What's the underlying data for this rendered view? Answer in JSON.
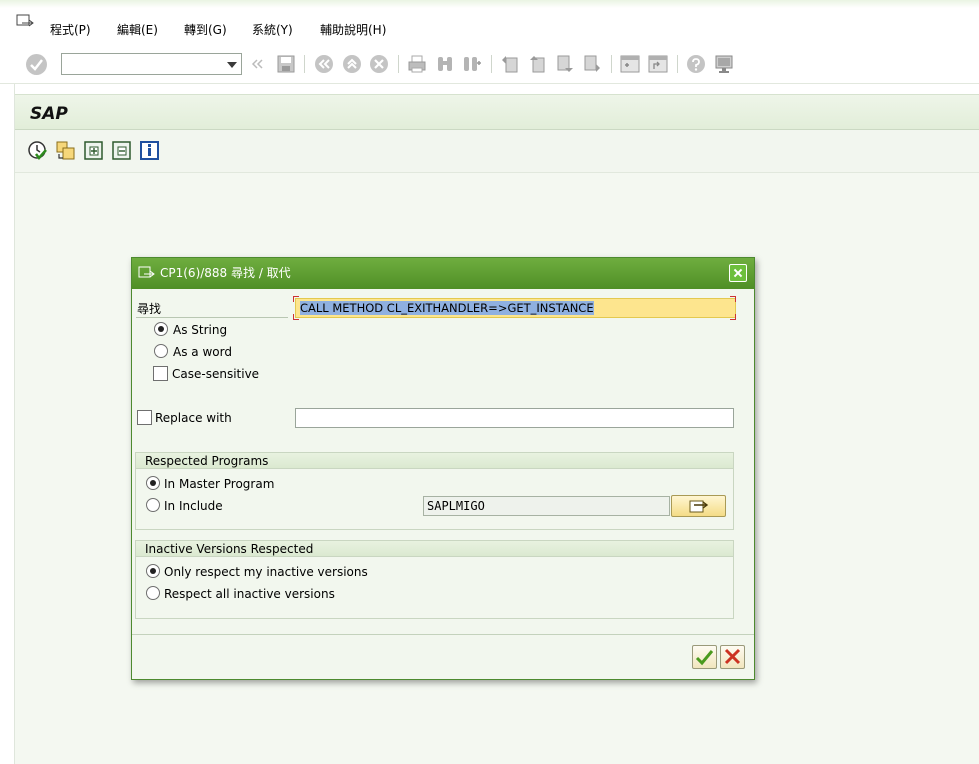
{
  "menu": {
    "items": [
      "程式(P)",
      "編輯(E)",
      "轉到(G)",
      "系統(Y)",
      "輔助說明(H)"
    ]
  },
  "toolbar": {
    "command_value": "",
    "icons": [
      "enter-icon",
      "save-icon",
      "back-icon",
      "exit-icon",
      "cancel-icon",
      "print-icon",
      "find-icon",
      "find-next-icon",
      "first-page-icon",
      "previous-page-icon",
      "next-page-icon",
      "last-page-icon",
      "create-session-icon",
      "shortcut-icon",
      "help-icon",
      "layout-icon"
    ]
  },
  "screen": {
    "title": "SAP",
    "app_icons": [
      "test-icon",
      "display-object-icon",
      "expand-icon",
      "collapse-icon",
      "info-icon"
    ]
  },
  "dialog": {
    "title": "CP1(6)/888 尋找 / 取代",
    "search_label": "尋找",
    "search_value": "CALL METHOD CL_EXITHANDLER=>GET_INSTANCE",
    "options": {
      "as_string": "As String",
      "as_word": "As a word",
      "case_sensitive": "Case-sensitive"
    },
    "replace_label": "Replace with",
    "replace_value": "",
    "respected_programs": {
      "header": "Respected Programs",
      "master": "In Master Program",
      "include": "In Include",
      "include_value": "SAPLMIGO"
    },
    "inactive_versions": {
      "header": "Inactive Versions Respected",
      "mine": "Only respect my inactive versions",
      "all": "Respect all inactive versions"
    }
  },
  "colors": {
    "dialog_title": "#4f8f26",
    "highlight_field": "#fde58e",
    "selection": "#8fb0e0",
    "cancel": "#cc3322",
    "confirm": "#4a9a1e"
  }
}
